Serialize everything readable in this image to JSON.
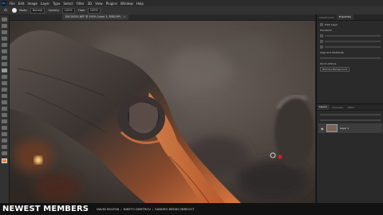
{
  "app": {
    "logo": "Ps",
    "menu": [
      "File",
      "Edit",
      "Image",
      "Layer",
      "Type",
      "Select",
      "Filter",
      "3D",
      "View",
      "Plugins",
      "Window",
      "Help"
    ]
  },
  "options_bar": {
    "mode_label": "Mode:",
    "mode_value": "Normal",
    "opacity_label": "Opacity:",
    "opacity_value": "100%",
    "flow_label": "Flow:",
    "flow_value": "100%"
  },
  "document": {
    "tab_label": "DSC00251.NEF @ 100% (Layer 1, RGB/16*)",
    "close_glyph": "×"
  },
  "panels": {
    "tabs": [
      "Adjustments",
      "Properties"
    ],
    "properties_heading": "Pixel Layer",
    "transform_label": "Transform",
    "align_label": "Align and Distribute",
    "quick_actions_label": "Quick Actions",
    "remove_bg": "Remove Background",
    "layers_tabs": [
      "Layers",
      "Channels",
      "Paths"
    ],
    "layer_name": "Layer 1",
    "eye_glyph": "◉"
  },
  "banner": {
    "heading": "NEWEST MEMBERS",
    "members": [
      "DAVID BOLTON",
      "NIKETO DIMITROV",
      "SANDRO BEDIN OBRECHT"
    ],
    "separator": "/"
  },
  "colors": {
    "wood_highlight": "#d9773f",
    "wood_shadow": "#2b2420",
    "brush_cursor": "#d21e1e"
  }
}
